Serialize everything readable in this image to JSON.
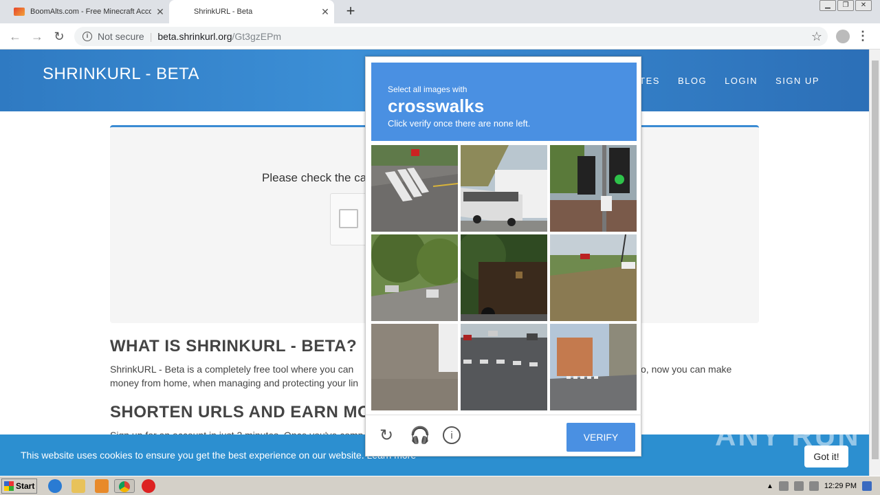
{
  "browser": {
    "tabs": [
      {
        "title": "BoomAlts.com - Free Minecraft Accou",
        "active": false
      },
      {
        "title": "ShrinkURL - Beta",
        "active": true
      }
    ],
    "new_tab_icon": "+",
    "url": {
      "security_label": "Not secure",
      "host": "beta.shrinkurl.org",
      "path": "/Gt3gzEPm"
    }
  },
  "site": {
    "brand": "SHRINKURL - BETA",
    "nav": [
      "RATES",
      "BLOG",
      "LOGIN",
      "SIGN UP"
    ],
    "card_message": "Please check the ca",
    "section1_heading": "WHAT IS SHRINKURL - BETA?",
    "section1_line1_a": "ShrinkURL - Beta is a completely free tool where you can",
    "section1_line1_b": "o, now you can make",
    "section1_line2": "money from home, when managing and protecting your lin",
    "section2_heading": "SHORTEN URLS AND EARN MO",
    "section2_line": "Sign up for an account in just 2 minutes. Once you've comp"
  },
  "cookie_bar": {
    "text": "This website uses cookies to ensure you get the best experience on our website. Learn more",
    "button": "Got it!"
  },
  "watermark": "ANY  RUN",
  "captcha": {
    "instruction_small": "Select all images with",
    "target": "crosswalks",
    "instruction_sub": "Click verify once there are none left.",
    "verify_label": "VERIFY",
    "tiles": [
      {
        "name": "crosswalk-street"
      },
      {
        "name": "bus"
      },
      {
        "name": "traffic-light"
      },
      {
        "name": "tree-road"
      },
      {
        "name": "truck"
      },
      {
        "name": "field-car"
      },
      {
        "name": "pavement"
      },
      {
        "name": "crosswalk-road"
      },
      {
        "name": "crosswalk-buildings"
      }
    ]
  },
  "taskbar": {
    "start_label": "Start",
    "clock": "12:29 PM"
  }
}
